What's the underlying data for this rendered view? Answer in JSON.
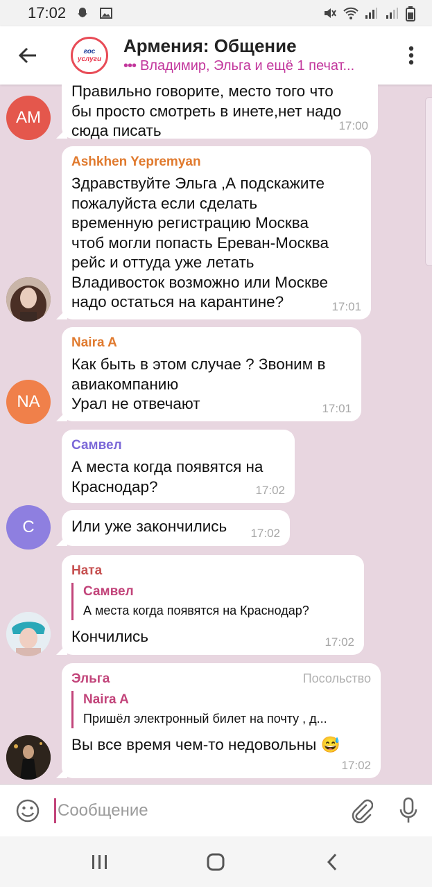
{
  "status_bar": {
    "time": "17:02"
  },
  "header": {
    "title": "Армения: Общение",
    "typing": "Владимир, Эльга и ещё 1 печат...",
    "avatar_line1": "гос",
    "avatar_line2": "услуги"
  },
  "colors": {
    "chat_background": "#e8d6e0",
    "accent": "#c2447a",
    "avatar_am": "#e4574c",
    "avatar_na": "#f0804a",
    "avatar_c": "#8e7fe0"
  },
  "messages": [
    {
      "sender": "",
      "text": "Правильно говорите, место того что\nбы просто смотреть в инете,нет надо\nсюда писать",
      "time": "17:00",
      "avatar": "AM"
    },
    {
      "sender": "Ashkhen Yepremyan",
      "text": "Здравствуйте Эльга ,А подскажите\nпожалуйста если сделать\nвременную регистрацию Москва\nчтоб могли  попасть Ереван-Москва\nрейс и оттуда уже летать\nВладивосток возможно или Москве\nнадо остаться на карантине?",
      "time": "17:01"
    },
    {
      "sender": "Naira A",
      "text": "Как быть в этом случае ? Звоним в\nавиакомпанию\nУрал не отвечают",
      "time": "17:01",
      "avatar": "NA"
    },
    {
      "sender": "Самвел",
      "text": "А места когда появятся на\nКраснодар?",
      "time": "17:02"
    },
    {
      "sender": "",
      "text": "Или уже закончились",
      "time": "17:02",
      "avatar": "С"
    },
    {
      "sender": "Ната",
      "reply_name": "Самвел",
      "reply_text": "А места когда появятся на Краснодар?",
      "text": "Кончились",
      "time": "17:02"
    },
    {
      "sender": "Эльга",
      "role": "Посольство",
      "reply_name": "Naira A",
      "reply_text": "Пришёл электронный билет на почту , д...",
      "text": "Вы все время чем-то недовольны 😅",
      "time": "17:02"
    }
  ],
  "input": {
    "placeholder": "Сообщение"
  }
}
